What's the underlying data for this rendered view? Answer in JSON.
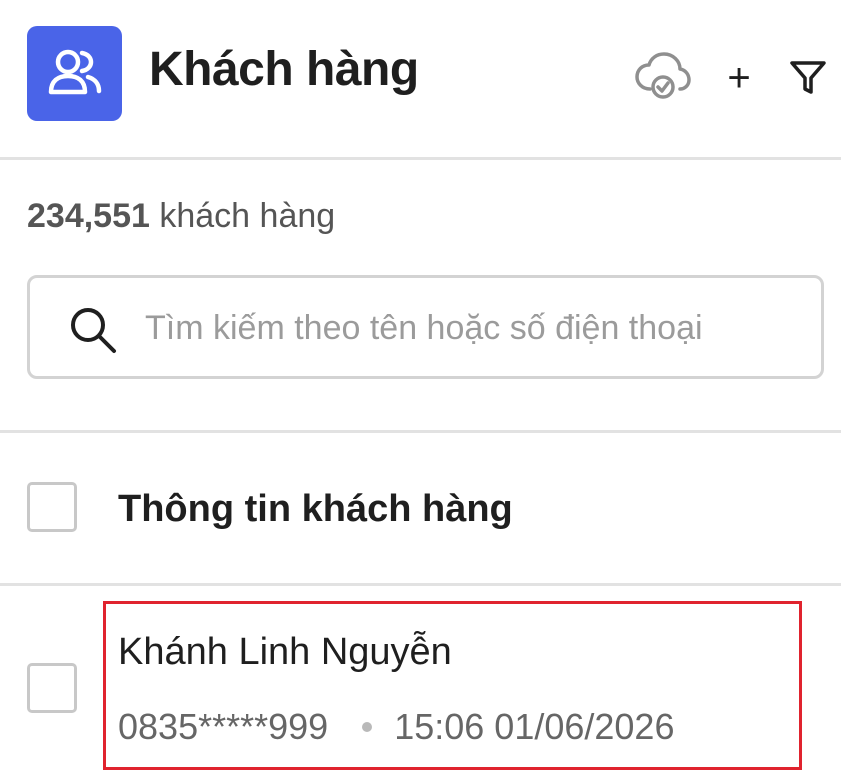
{
  "header": {
    "title": "Khách hàng",
    "app_icon": "users-icon",
    "accent_color": "#4a64e8",
    "actions": [
      {
        "name": "cloud-sync-icon"
      },
      {
        "label": "+",
        "name": "add-icon"
      },
      {
        "name": "filter-icon"
      }
    ]
  },
  "summary": {
    "count": "234,551",
    "unit": "khách hàng"
  },
  "search": {
    "placeholder": "Tìm kiếm theo tên hoặc số điện thoại",
    "value": ""
  },
  "table": {
    "header_label": "Thông tin khách hàng",
    "rows": [
      {
        "name": "Khánh Linh Nguyễn",
        "phone": "0835*****999",
        "datetime": "15:06 01/06/2026",
        "highlighted": true,
        "highlight_color": "#e0232e"
      }
    ]
  }
}
